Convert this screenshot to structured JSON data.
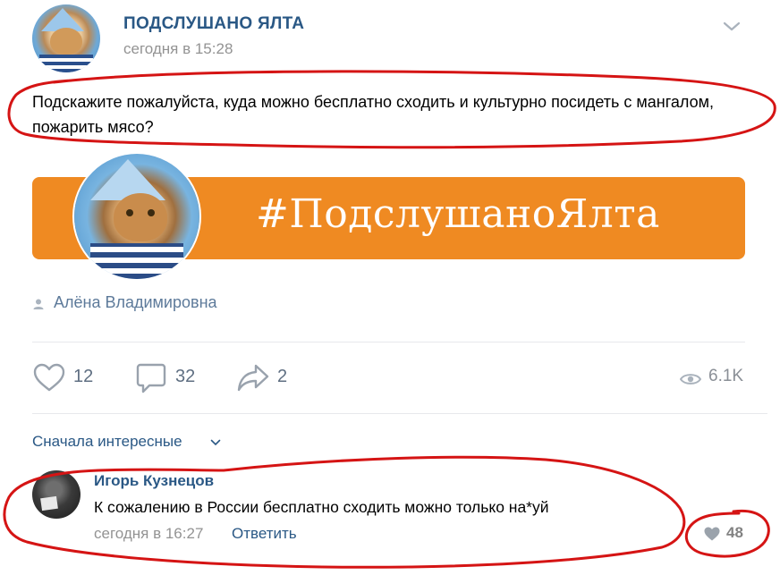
{
  "post": {
    "group_name": "ПОДСЛУШАНО ЯЛТА",
    "time": "сегодня в 15:28",
    "text": "Подскажите пожалуйста, куда можно бесплатно сходить и культурно посидеть с мангалом, пожарить мясо?",
    "banner_text": "#ПодслушаноЯлта",
    "author": "Алёна Владимировна",
    "likes": "12",
    "comments": "32",
    "shares": "2",
    "views": "6.1K"
  },
  "comments_section": {
    "sort_label": "Сначала интересные",
    "items": [
      {
        "author": "Игорь Кузнецов",
        "text": "К сожалению в России бесплатно сходить можно только на*уй",
        "time": "сегодня в 16:27",
        "reply_label": "Ответить",
        "likes": "48"
      }
    ]
  },
  "colors": {
    "link": "#2a5885",
    "muted": "#939393",
    "banner": "#ef8a22",
    "annotation": "#d51414"
  },
  "icons": {
    "menu": "chevron-down-icon",
    "author": "person-icon",
    "like": "heart-icon",
    "comment": "comment-bubble-icon",
    "share": "share-arrow-icon",
    "views": "eye-icon"
  }
}
